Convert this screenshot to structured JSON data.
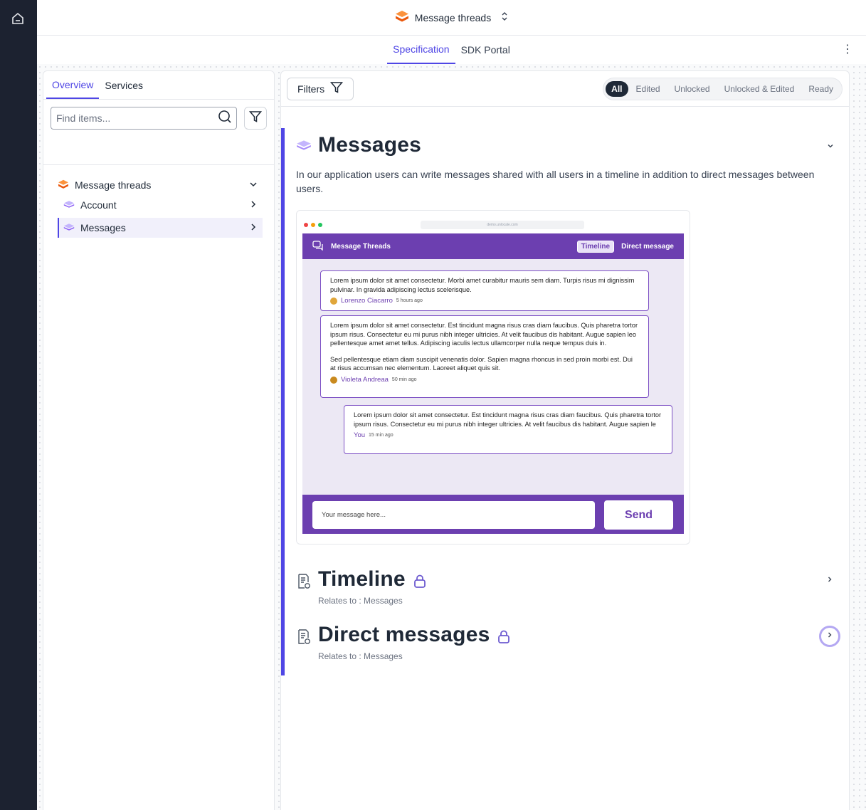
{
  "topbar": {
    "project_name": "Message threads"
  },
  "subnav": {
    "tabs": [
      {
        "label": "Specification"
      },
      {
        "label": "SDK Portal"
      }
    ],
    "more_glyph": "⋮"
  },
  "left_panel": {
    "tabs": [
      {
        "label": "Overview"
      },
      {
        "label": "Services"
      }
    ],
    "search_placeholder": "Find items...",
    "tree": [
      {
        "label": "Message threads"
      },
      {
        "label": "Account"
      },
      {
        "label": "Messages"
      }
    ]
  },
  "right_panel": {
    "filters_label": "Filters",
    "status_filters": [
      "All",
      "Edited",
      "Unlocked",
      "Unlocked & Edited",
      "Ready"
    ],
    "section": {
      "title": "Messages",
      "description": "In our application users can write messages shared with all users in a timeline in addition to direct messages between users."
    },
    "requirements": [
      {
        "title": "Timeline",
        "relates": "Relates to : Messages"
      },
      {
        "title": "Direct messages",
        "relates": "Relates to : Messages"
      }
    ]
  },
  "mockup": {
    "url": "demo.unlocale.com",
    "app_title": "Message Threads",
    "nav": [
      "Timeline",
      "Direct message"
    ],
    "messages": [
      {
        "paragraphs": [
          "Lorem ipsum dolor sit amet consectetur. Morbi amet curabitur mauris sem diam. Turpis risus mi dignissim pulvinar. In gravida adipiscing lectus scelerisque."
        ],
        "author": "Lorenzo Ciacarro",
        "time": "5 hours ago"
      },
      {
        "paragraphs": [
          "Lorem ipsum dolor sit amet consectetur. Est tincidunt magna risus cras diam faucibus. Quis pharetra tortor ipsum risus. Consectetur eu mi purus nibh integer ultricies. At velit faucibus dis habitant. Augue sapien leo pellentesque amet amet tellus. Adipiscing iaculis lectus ullamcorper nulla neque tempus duis in.",
          "Sed pellentesque etiam diam suscipit venenatis dolor. Sapien magna rhoncus in sed proin morbi est. Dui at risus accumsan nec elementum. Laoreet aliquet quis sit."
        ],
        "author": "Violeta Andreaa",
        "time": "50 min ago"
      },
      {
        "paragraphs": [
          "Lorem ipsum dolor sit amet consectetur. Est tincidunt magna risus cras diam faucibus. Quis pharetra tortor ipsum risus. Consectetur eu mi purus nibh integer ultricies. At velit faucibus dis habitant. Augue sapien le"
        ],
        "author": "You",
        "time": "15 min ago"
      }
    ],
    "composer_placeholder": "Your message here...",
    "send_label": "Send"
  },
  "icons": {
    "home": "home-icon",
    "project": "stack-orange-icon",
    "submodule": "stack-purple-icon",
    "search": "search-icon",
    "filter": "filter-icon",
    "chevron_down": "chevron-down-icon",
    "chevron_right": "chevron-right-icon",
    "requirement": "requirement-doc-icon",
    "lock": "lock-icon"
  },
  "colors": {
    "accent": "#4f46e5",
    "rail": "#1c2230",
    "project_icon": "#f97316",
    "submodule_icon": "#a78bfa",
    "mock_brand": "#6c3fb0",
    "lock": "#6d5bd0"
  }
}
